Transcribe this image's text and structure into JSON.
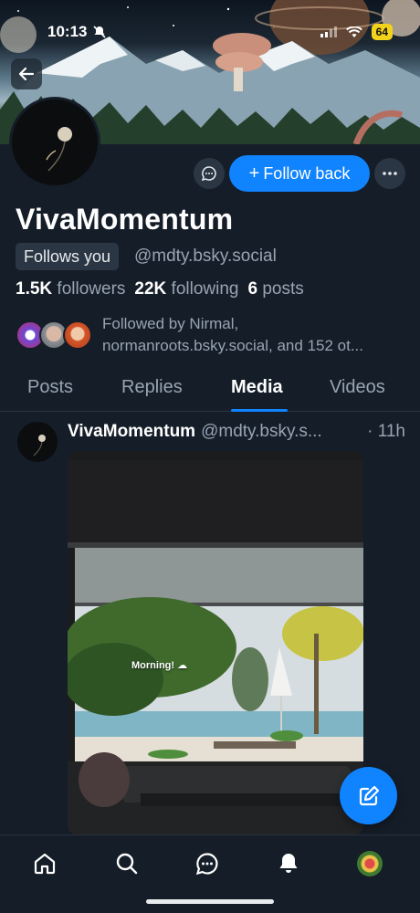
{
  "status_bar": {
    "time": "10:13",
    "battery": "64"
  },
  "profile": {
    "display_name": "VivaMomentum",
    "follows_you_badge": "Follows you",
    "handle": "@mdty.bsky.social",
    "follow_button_label": "Follow back",
    "stats": {
      "followers_count": "1.5K",
      "followers_label": "followers",
      "following_count": "22K",
      "following_label": "following",
      "posts_count": "6",
      "posts_label": "posts"
    },
    "followed_by_line1": "Followed by Nirmal,",
    "followed_by_line2": "normanroots.bsky.social, and 152 ot..."
  },
  "tabs": [
    {
      "label": "Posts",
      "active": false
    },
    {
      "label": "Replies",
      "active": false
    },
    {
      "label": "Media",
      "active": true
    },
    {
      "label": "Videos",
      "active": false
    }
  ],
  "post": {
    "author": "VivaMomentum",
    "handle": "@mdty.bsky.s...",
    "time": "· 11h",
    "media_caption": "Morning! ☁"
  },
  "icons": {
    "back": "arrow-left-icon",
    "message": "chat-bubble-icon",
    "more": "ellipsis-icon",
    "compose": "compose-icon",
    "nav": [
      "home-icon",
      "search-icon",
      "chat-icon",
      "notifications-icon",
      "profile-avatar"
    ]
  },
  "colors": {
    "accent": "#1083fe",
    "background": "#151d28",
    "muted_text": "#98a4b3",
    "battery": "#f2d21b"
  }
}
